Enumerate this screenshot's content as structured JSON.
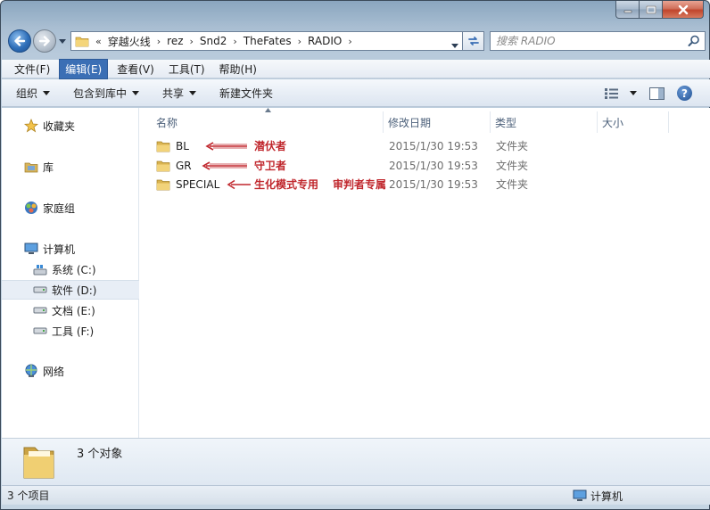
{
  "window": {
    "controls": [
      "minimize-icon",
      "maximize-icon",
      "close-icon"
    ]
  },
  "address_bar": {
    "prefix": "«",
    "crumbs": [
      "穿越火线",
      "rez",
      "Snd2",
      "TheFates",
      "RADIO"
    ],
    "separator": "›"
  },
  "search": {
    "placeholder": "搜索 RADIO"
  },
  "menu": {
    "items": [
      "文件(F)",
      "编辑(E)",
      "查看(V)",
      "工具(T)",
      "帮助(H)"
    ],
    "active": "编辑(E)"
  },
  "commands": {
    "organize": "组织",
    "include_in_library": "包含到库中",
    "share": "共享",
    "new_folder": "新建文件夹"
  },
  "nav_pane": {
    "favorites": "收藏夹",
    "libraries": "库",
    "homegroup": "家庭组",
    "computer": "计算机",
    "drives": [
      "系统 (C:)",
      "软件 (D:)",
      "文档 (E:)",
      "工具 (F:)"
    ],
    "selected_drive": "软件 (D:)",
    "network": "网络"
  },
  "columns": {
    "name": "名称",
    "date_modified": "修改日期",
    "type": "类型",
    "size": "大小"
  },
  "files": [
    {
      "name": "BL",
      "date": "2015/1/30 19:53",
      "type": "文件夹",
      "annotations": [
        "潜伏者"
      ]
    },
    {
      "name": "GR",
      "date": "2015/1/30 19:53",
      "type": "文件夹",
      "annotations": [
        "守卫者"
      ]
    },
    {
      "name": "SPECIAL",
      "date": "2015/1/30 19:53",
      "type": "文件夹",
      "annotations": [
        "生化模式专用",
        "审判者专属"
      ]
    }
  ],
  "details_pane": {
    "count": "3 个对象"
  },
  "status_bar": {
    "items_count": "3 个项目",
    "location": "计算机"
  },
  "colors": {
    "annotation_red": "#c0272d",
    "menu_active": "#3b6fb5"
  }
}
